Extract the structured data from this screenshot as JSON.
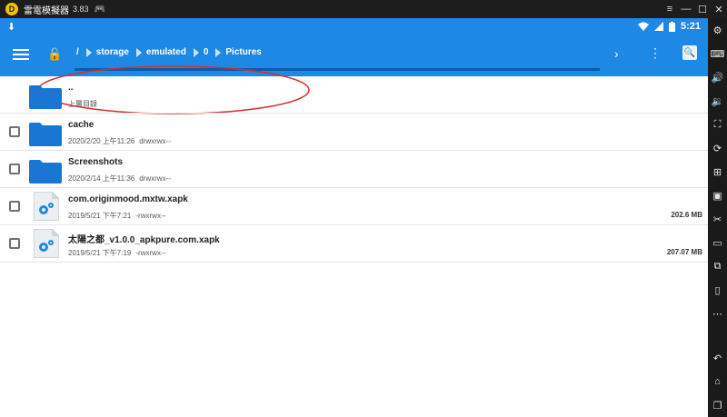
{
  "emulator": {
    "title": "雷電模擬器",
    "version": "3.83",
    "logo_letter": "D",
    "window_controls": [
      "≡",
      "—",
      "☐",
      "✕"
    ],
    "sidebar_icons": [
      "settings-icon",
      "keyboard-icon",
      "volume-up-icon",
      "volume-down-icon",
      "fullscreen-icon",
      "rotate-icon",
      "install-apk-icon",
      "screenshot-icon",
      "scissors-icon",
      "record-icon",
      "sync-icon",
      "shake-icon",
      "more-icon",
      "back-icon",
      "home-icon",
      "recent-apps-icon"
    ]
  },
  "statusbar": {
    "time": "5:21"
  },
  "toolbar": {
    "breadcrumbs": [
      "/",
      "storage",
      "emulated",
      "0",
      "Pictures"
    ],
    "progress_fraction": 0.0
  },
  "files": [
    {
      "name": "..",
      "meta": "上層目錄",
      "perm": "",
      "size": "",
      "kind": "parent"
    },
    {
      "name": "cache",
      "meta": "2020/2/20 上午11:26",
      "perm": "drwxrwx--",
      "size": "",
      "kind": "folder"
    },
    {
      "name": "Screenshots",
      "meta": "2020/2/14 上午11:36",
      "perm": "drwxrwx--",
      "size": "",
      "kind": "folder"
    },
    {
      "name": "com.originmood.mxtw.xapk",
      "meta": "2019/5/21 下午7:21",
      "perm": "-rwxrwx--",
      "size": "202.6 MB",
      "kind": "file"
    },
    {
      "name": "太陽之都_v1.0.0_apkpure.com.xapk",
      "meta": "2019/5/21 下午7:19",
      "perm": "-rwxrwx--",
      "size": "207.07 MB",
      "kind": "file"
    }
  ],
  "colors": {
    "accent": "#1e88e5",
    "folder": "#1976d2",
    "annotation": "#d32f2f"
  }
}
